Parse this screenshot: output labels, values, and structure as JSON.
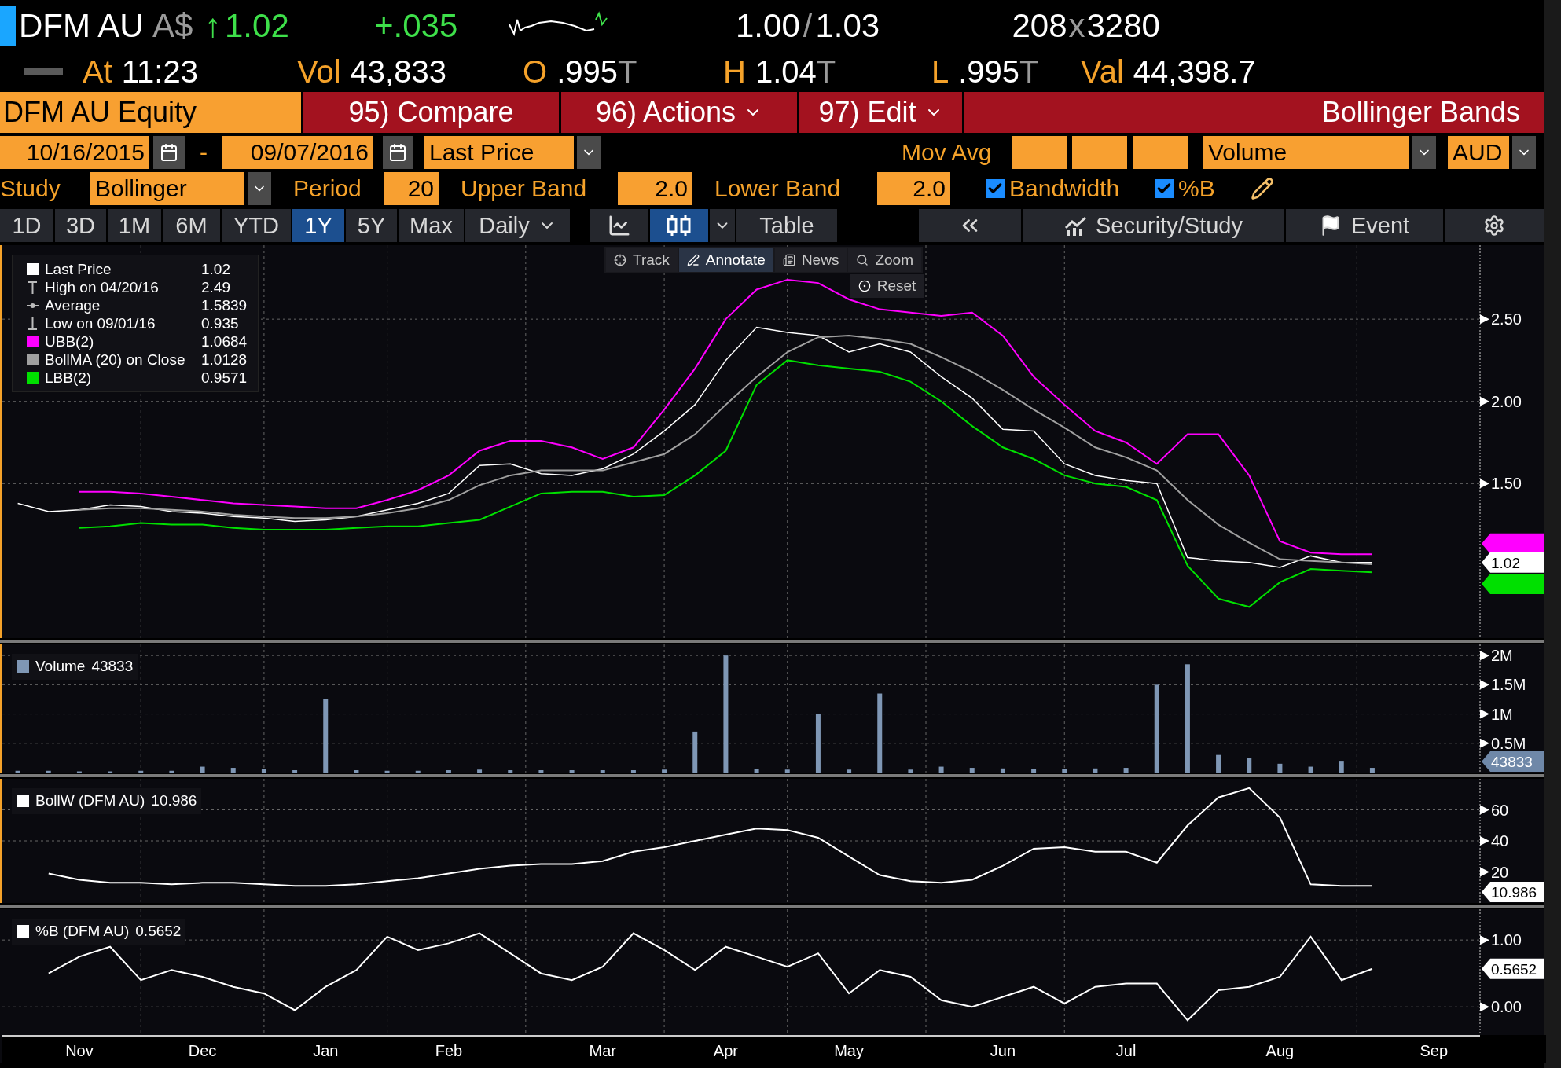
{
  "quote": {
    "ticker": "DFM AU",
    "currency": "A$",
    "arrow": "↑",
    "last": "1.02",
    "change": "+.035",
    "bid": "1.00",
    "bid_ask_separator": "/",
    "ask": "1.03",
    "bid_size": "208",
    "size_separator": "x",
    "ask_size": "3280"
  },
  "stats": [
    {
      "label": "At",
      "value": "11:23"
    },
    {
      "label": "Vol",
      "value": "43,833"
    },
    {
      "label": "O",
      "value": ".995",
      "flag": "T"
    },
    {
      "label": "H",
      "value": "1.04",
      "flag": "T"
    },
    {
      "label": "L",
      "value": ".995",
      "flag": "T"
    },
    {
      "label": "Val",
      "value": "44,398.7"
    }
  ],
  "toolbar": {
    "security": "DFM AU Equity",
    "buttons": [
      {
        "label": "95) Compare",
        "menu": false
      },
      {
        "label": "96) Actions",
        "menu": true
      },
      {
        "label": "97) Edit",
        "menu": true
      }
    ],
    "title": "Bollinger Bands"
  },
  "range": {
    "start": "10/16/2015",
    "separator": "-",
    "end": "09/07/2016",
    "field": "Last Price",
    "mov_avg_label": "Mov Avg",
    "lower_field": "Volume",
    "currency": "AUD"
  },
  "study": {
    "label": "Study",
    "value": "Bollinger",
    "params": [
      {
        "label": "Period",
        "value": "20"
      },
      {
        "label": "Upper Band",
        "value": "2.0"
      },
      {
        "label": "Lower Band",
        "value": "2.0"
      }
    ],
    "options": [
      {
        "label": "Bandwidth",
        "checked": true
      },
      {
        "label": "%B",
        "checked": true
      }
    ]
  },
  "periods": [
    {
      "label": "1D",
      "selected": false
    },
    {
      "label": "3D",
      "selected": false
    },
    {
      "label": "1M",
      "selected": false
    },
    {
      "label": "6M",
      "selected": false
    },
    {
      "label": "YTD",
      "selected": false
    },
    {
      "label": "1Y",
      "selected": true
    },
    {
      "label": "5Y",
      "selected": false
    },
    {
      "label": "Max",
      "selected": false
    }
  ],
  "frequency": "Daily",
  "chart_types": [
    {
      "kind": "line",
      "selected": false
    },
    {
      "kind": "candle",
      "selected": true
    }
  ],
  "table_button": "Table",
  "security_study_button": "Security/Study",
  "event_button": "Event",
  "chart_toolbar": [
    {
      "label": "Track",
      "kind": "track",
      "selected": false
    },
    {
      "label": "Annotate",
      "kind": "annotate",
      "selected": true
    },
    {
      "label": "News",
      "kind": "news",
      "selected": false
    },
    {
      "label": "Zoom",
      "kind": "zoom",
      "selected": false
    }
  ],
  "reset_button": "Reset",
  "legend": [
    {
      "kind": "series",
      "value": "1.02"
    },
    {
      "kind": "high",
      "label": "High on 04/20/16",
      "value": "2.49"
    },
    {
      "kind": "average",
      "label": "Average",
      "value": "1.5839"
    },
    {
      "kind": "low",
      "label": "Low on 09/01/16",
      "value": "0.935"
    },
    {
      "kind": "series",
      "value": "1.0684"
    },
    {
      "kind": "series",
      "value": "1.0128"
    },
    {
      "kind": "series",
      "value": "0.9571"
    }
  ],
  "price_chart": {
    "flag": "1.02",
    "chart_data": {
      "type": "line",
      "grid": true,
      "legend": "upper left",
      "categories": [
        null,
        null,
        null,
        null,
        null,
        null,
        null,
        null,
        null,
        null,
        null,
        null,
        null,
        null,
        null,
        null,
        null,
        null,
        null,
        null,
        null,
        null,
        null,
        null,
        null,
        null,
        null,
        null,
        null,
        null,
        null,
        null,
        null,
        null,
        null,
        null,
        null,
        null,
        null,
        null,
        null,
        null,
        null,
        null,
        null,
        null,
        null,
        null
      ],
      "ylim": [
        0.56,
        2.95
      ],
      "yticks": [
        {
          "value": 2.5,
          "label": "2.50"
        },
        {
          "value": 2,
          "label": "2.00"
        },
        {
          "value": 1.5,
          "label": "1.50"
        }
      ],
      "series": [
        {
          "name": "Last Price",
          "color": "#ffffff",
          "values": [
            1.38,
            1.33,
            1.34,
            1.37,
            1.36,
            1.33,
            1.32,
            1.3,
            1.29,
            1.27,
            1.28,
            1.3,
            1.34,
            1.38,
            1.44,
            1.61,
            1.62,
            1.56,
            1.55,
            1.59,
            1.68,
            1.82,
            1.98,
            2.25,
            2.45,
            2.42,
            2.4,
            2.3,
            2.35,
            2.3,
            2.15,
            2.02,
            1.83,
            1.82,
            1.62,
            1.55,
            1.52,
            1.5,
            1.05,
            1.03,
            1.02,
            0.99,
            1.06,
            1.02,
            1.02,
            null,
            null,
            null
          ]
        },
        {
          "name": "UBB(2)",
          "color": "#ff00ff",
          "values": [
            null,
            null,
            1.45,
            1.45,
            1.44,
            1.42,
            1.4,
            1.38,
            1.37,
            1.36,
            1.35,
            1.35,
            1.4,
            1.46,
            1.55,
            1.7,
            1.76,
            1.76,
            1.72,
            1.65,
            1.72,
            1.95,
            2.2,
            2.5,
            2.68,
            2.74,
            2.72,
            2.62,
            2.56,
            2.54,
            2.52,
            2.54,
            2.4,
            2.15,
            1.98,
            1.82,
            1.75,
            1.62,
            1.8,
            1.8,
            1.55,
            1.15,
            1.08,
            1.07,
            1.07,
            null,
            null,
            null
          ]
        },
        {
          "name": "BollMA (20) on Close",
          "color": "#a0a0a0",
          "values": [
            null,
            null,
            1.34,
            1.35,
            1.35,
            1.34,
            1.33,
            1.31,
            1.3,
            1.29,
            1.29,
            1.3,
            1.32,
            1.35,
            1.4,
            1.49,
            1.55,
            1.58,
            1.58,
            1.58,
            1.63,
            1.68,
            1.8,
            1.98,
            2.15,
            2.3,
            2.39,
            2.4,
            2.38,
            2.35,
            2.27,
            2.18,
            2.07,
            1.95,
            1.84,
            1.72,
            1.66,
            1.58,
            1.4,
            1.25,
            1.14,
            1.04,
            1.03,
            1.02,
            1.01,
            null,
            null,
            null
          ]
        },
        {
          "name": "LBB(2)",
          "color": "#00e000",
          "values": [
            null,
            null,
            1.23,
            1.24,
            1.26,
            1.25,
            1.25,
            1.23,
            1.22,
            1.22,
            1.22,
            1.23,
            1.24,
            1.24,
            1.26,
            1.28,
            1.36,
            1.44,
            1.45,
            1.45,
            1.42,
            1.43,
            1.55,
            1.7,
            2.1,
            2.25,
            2.22,
            2.2,
            2.18,
            2.12,
            2.0,
            1.85,
            1.72,
            1.65,
            1.55,
            1.5,
            1.48,
            1.4,
            1.0,
            0.8,
            0.75,
            0.9,
            0.98,
            0.97,
            0.96,
            null,
            null,
            null
          ]
        }
      ]
    }
  },
  "volume_panel": {
    "legend_value": "43833",
    "flag": "43833",
    "chart_data": {
      "type": "bar",
      "grid": true,
      "legend": "upper left",
      "categories": [
        null,
        null,
        null,
        null,
        null,
        null,
        null,
        null,
        null,
        null,
        null,
        null,
        null,
        null,
        null,
        null,
        null,
        null,
        null,
        null,
        null,
        null,
        null,
        null,
        null,
        null,
        null,
        null,
        null,
        null,
        null,
        null,
        null,
        null,
        null,
        null,
        null,
        null,
        null,
        null,
        null,
        null,
        null,
        null,
        null,
        null,
        null,
        null
      ],
      "ylim": [
        0,
        2.19
      ],
      "yticks": [
        {
          "value": 2,
          "label": "2M"
        },
        {
          "value": 1.5,
          "label": "1.5M"
        },
        {
          "value": 1,
          "label": "1M"
        },
        {
          "value": 0.5,
          "label": "0.5M"
        }
      ],
      "series": [
        {
          "name": "Volume",
          "color": "#7f97b5",
          "values": [
            0.03,
            0.03,
            0.02,
            0.02,
            0.03,
            0.03,
            0.1,
            0.08,
            0.06,
            0.04,
            1.25,
            0.04,
            0.03,
            0.03,
            0.04,
            0.05,
            0.04,
            0.04,
            0.04,
            0.04,
            0.04,
            0.05,
            0.7,
            2.0,
            0.06,
            0.05,
            1.0,
            0.05,
            1.35,
            0.05,
            0.1,
            0.08,
            0.07,
            0.06,
            0.06,
            0.07,
            0.08,
            1.5,
            1.85,
            0.3,
            0.25,
            0.15,
            0.1,
            0.2,
            0.08,
            null,
            null,
            null
          ]
        }
      ]
    }
  },
  "bollw_panel": {
    "legend_value": "10.986",
    "flag": "10.986",
    "chart_data": {
      "type": "line",
      "grid": true,
      "legend": "upper left",
      "categories": [
        null,
        null,
        null,
        null,
        null,
        null,
        null,
        null,
        null,
        null,
        null,
        null,
        null,
        null,
        null,
        null,
        null,
        null,
        null,
        null,
        null,
        null,
        null,
        null,
        null,
        null,
        null,
        null,
        null,
        null,
        null,
        null,
        null,
        null,
        null,
        null,
        null,
        null,
        null,
        null,
        null,
        null,
        null,
        null,
        null,
        null,
        null,
        null
      ],
      "ylim": [
        0,
        80
      ],
      "yticks": [
        {
          "value": 60,
          "label": "60"
        },
        {
          "value": 40,
          "label": "40"
        },
        {
          "value": 20,
          "label": "20"
        }
      ],
      "series": [
        {
          "name": "BollW (DFM AU)",
          "color": "#ffffff",
          "values": [
            null,
            19,
            15,
            13,
            13,
            12,
            13,
            13,
            12,
            11,
            11,
            12,
            14,
            16,
            19,
            22,
            24,
            25,
            25,
            27,
            33,
            36,
            40,
            44,
            48,
            47,
            42,
            30,
            18,
            14,
            13,
            15,
            24,
            35,
            36,
            33,
            33,
            26,
            50,
            68,
            74,
            55,
            12,
            11,
            11,
            null,
            null,
            null
          ]
        }
      ]
    }
  },
  "pctb_panel": {
    "legend_value": "0.5652",
    "flag": "0.5652",
    "chart_data": {
      "type": "line",
      "grid": true,
      "legend": "upper left",
      "categories": [
        null,
        null,
        "Nov",
        null,
        null,
        null,
        "Dec",
        null,
        null,
        null,
        "Jan",
        null,
        null,
        null,
        "Feb",
        null,
        null,
        null,
        null,
        "Mar",
        null,
        null,
        null,
        "Apr",
        null,
        null,
        null,
        "May",
        null,
        null,
        null,
        null,
        "Jun",
        null,
        null,
        null,
        "Jul",
        null,
        null,
        null,
        null,
        "Aug",
        null,
        null,
        null,
        null,
        "Sep",
        null
      ],
      "ylim": [
        -0.42,
        1.46
      ],
      "yticks": [
        {
          "value": 1,
          "label": "1.00"
        },
        {
          "value": 0,
          "label": "0.00"
        }
      ],
      "series": [
        {
          "name": "%B (DFM AU)",
          "color": "#ffffff",
          "values": [
            null,
            0.5,
            0.75,
            0.9,
            0.4,
            0.55,
            0.45,
            0.3,
            0.2,
            -0.05,
            0.3,
            0.55,
            1.05,
            0.85,
            0.95,
            1.1,
            0.8,
            0.5,
            0.4,
            0.6,
            1.1,
            0.85,
            0.55,
            0.9,
            0.75,
            0.6,
            0.8,
            0.2,
            0.55,
            0.45,
            0.1,
            0.0,
            0.15,
            0.3,
            0.05,
            0.3,
            0.35,
            0.35,
            -0.2,
            0.25,
            0.3,
            0.45,
            1.05,
            0.4,
            0.57,
            null,
            null,
            null
          ]
        }
      ]
    }
  }
}
